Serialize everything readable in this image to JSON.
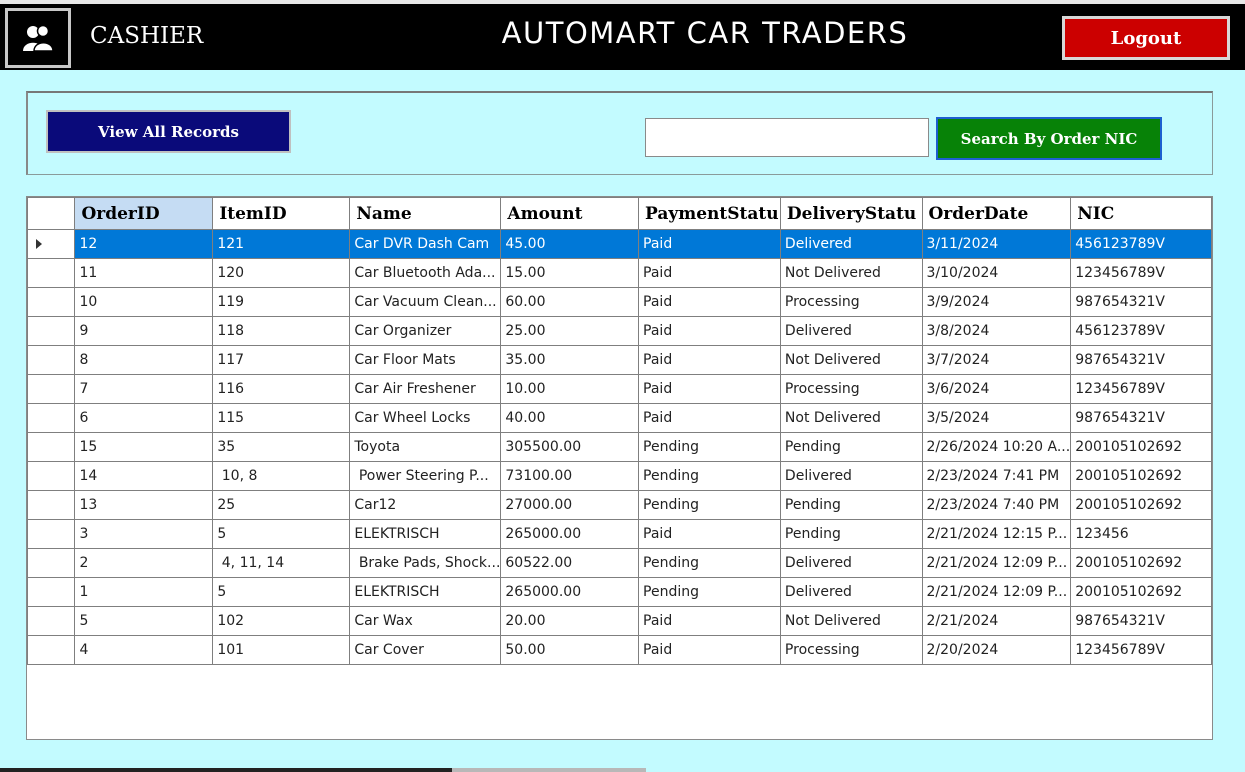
{
  "header": {
    "role": "CASHIER",
    "title": "AUTOMART CAR TRADERS",
    "logout_label": "Logout",
    "avatar_icon": "users-icon"
  },
  "toolbar": {
    "view_all_label": "View All Records",
    "search_placeholder": "",
    "search_button_label": "Search By Order NIC"
  },
  "table": {
    "columns": [
      "OrderID",
      "ItemID",
      "Name",
      "Amount",
      "PaymentStatu",
      "DeliveryStatu",
      "OrderDate",
      "NIC"
    ],
    "rows": [
      [
        "12",
        "121",
        "Car DVR Dash Cam",
        "45.00",
        "Paid",
        "Delivered",
        "3/11/2024",
        "456123789V"
      ],
      [
        "11",
        "120",
        "Car Bluetooth Ada...",
        "15.00",
        "Paid",
        "Not Delivered",
        "3/10/2024",
        "123456789V"
      ],
      [
        "10",
        "119",
        "Car Vacuum Clean...",
        "60.00",
        "Paid",
        "Processing",
        "3/9/2024",
        "987654321V"
      ],
      [
        "9",
        "118",
        "Car Organizer",
        "25.00",
        "Paid",
        "Delivered",
        "3/8/2024",
        "456123789V"
      ],
      [
        "8",
        "117",
        "Car Floor Mats",
        "35.00",
        "Paid",
        "Not Delivered",
        "3/7/2024",
        "987654321V"
      ],
      [
        "7",
        "116",
        "Car Air Freshener",
        "10.00",
        "Paid",
        "Processing",
        "3/6/2024",
        "123456789V"
      ],
      [
        "6",
        "115",
        "Car Wheel Locks",
        "40.00",
        "Paid",
        "Not Delivered",
        "3/5/2024",
        "987654321V"
      ],
      [
        "15",
        "35",
        "Toyota",
        "305500.00",
        "Pending",
        "Pending",
        "2/26/2024 10:20 A...",
        "200105102692"
      ],
      [
        "14",
        " 10, 8",
        " Power Steering P...",
        "73100.00",
        "Pending",
        "Delivered",
        "2/23/2024 7:41 PM",
        "200105102692"
      ],
      [
        "13",
        "25",
        "Car12",
        "27000.00",
        "Pending",
        "Pending",
        "2/23/2024 7:40 PM",
        "200105102692"
      ],
      [
        "3",
        "5",
        "ELEKTRISCH",
        "265000.00",
        "Paid",
        "Pending",
        "2/21/2024 12:15 P...",
        "123456"
      ],
      [
        "2",
        " 4, 11, 14",
        " Brake Pads, Shock...",
        "60522.00",
        "Pending",
        "Delivered",
        "2/21/2024 12:09 P...",
        "200105102692"
      ],
      [
        "1",
        "5",
        "ELEKTRISCH",
        "265000.00",
        "Pending",
        "Delivered",
        "2/21/2024 12:09 P...",
        "200105102692"
      ],
      [
        "5",
        "102",
        "Car Wax",
        "20.00",
        "Paid",
        "Not Delivered",
        "2/21/2024",
        "987654321V"
      ],
      [
        "4",
        "101",
        "Car Cover",
        "50.00",
        "Paid",
        "Processing",
        "2/20/2024",
        "123456789V"
      ]
    ],
    "selected_row": 0,
    "sorted_column": 0
  },
  "colors": {
    "background": "#c3fbff",
    "header_bg": "#000000",
    "logout_bg": "#cc0000",
    "view_all_bg": "#0a0a7a",
    "search_bg": "#078207",
    "selection": "#0078d7"
  }
}
